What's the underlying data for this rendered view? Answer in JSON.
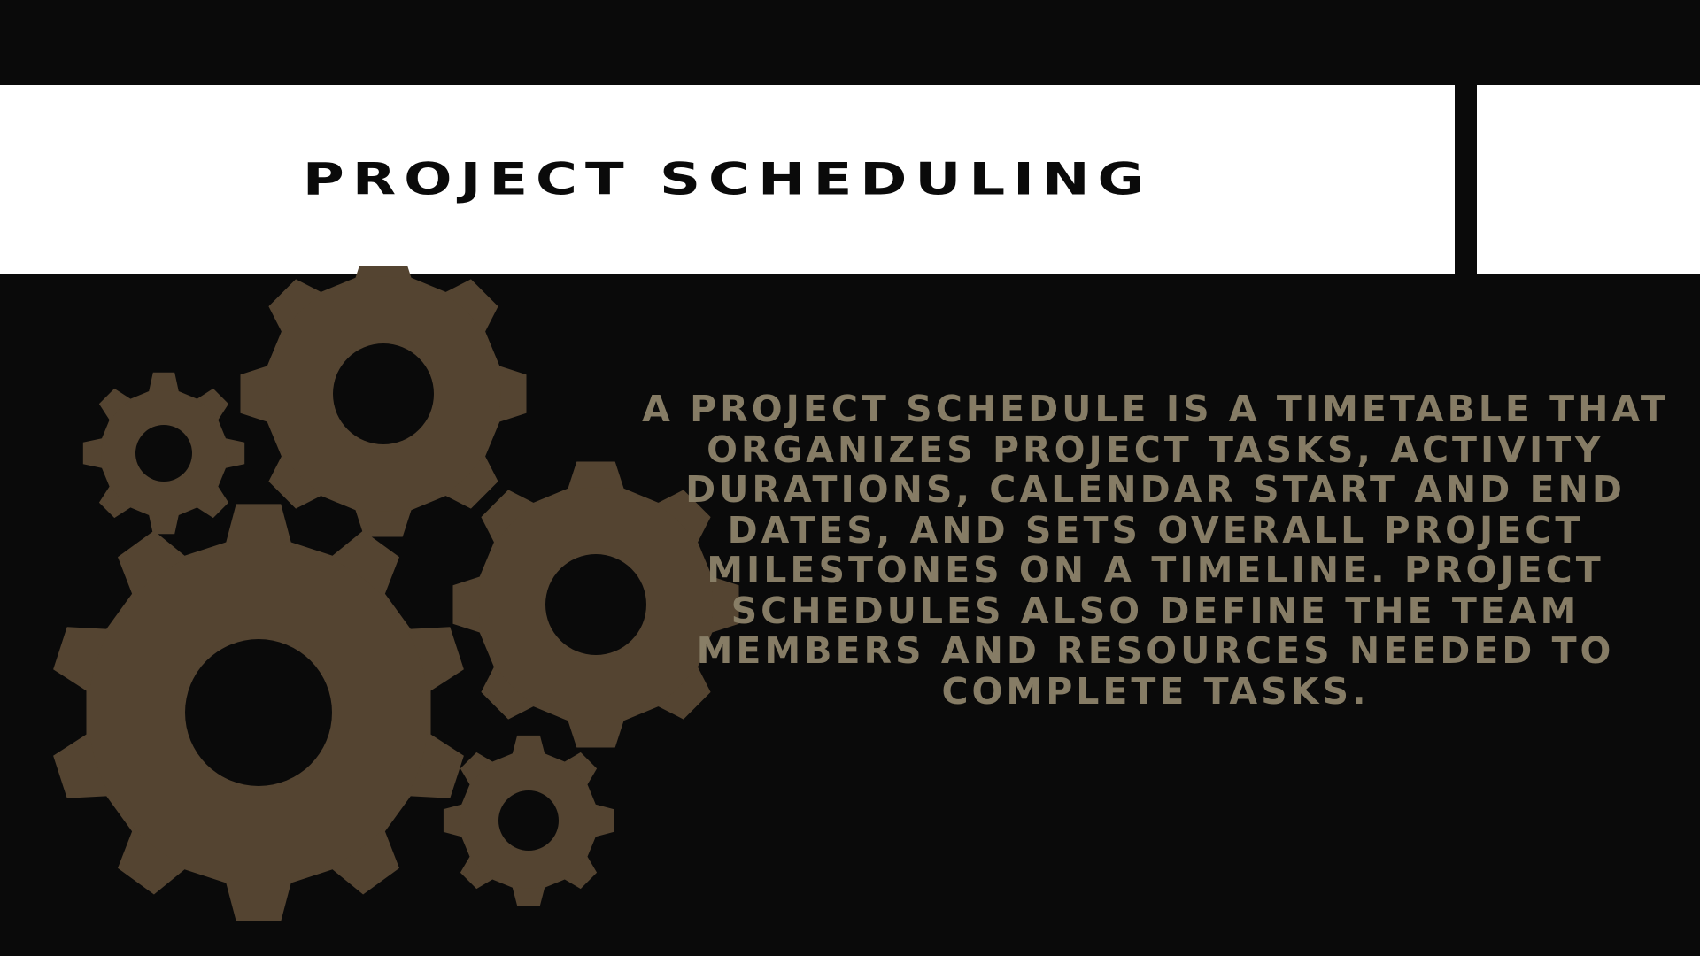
{
  "slide": {
    "title": "PROJECT SCHEDULING",
    "body": "A PROJECT SCHEDULE IS A TIMETABLE THAT ORGANIZES PROJECT TASKS, ACTIVITY DURATIONS, CALENDAR START AND END DATES, AND SETS OVERALL PROJECT MILESTONES ON A TIMELINE. PROJECT SCHEDULES ALSO DEFINE THE TEAM MEMBERS AND RESOURCES NEEDED TO COMPLETE TASKS."
  },
  "colors": {
    "background": "#0a0a0a",
    "banner": "#ffffff",
    "gear": "#544431",
    "body_text": "#8a8068"
  },
  "icons": {
    "gears": [
      "gear-icon-large",
      "gear-icon-top",
      "gear-icon-small-left",
      "gear-icon-right",
      "gear-icon-small-bottom"
    ]
  }
}
